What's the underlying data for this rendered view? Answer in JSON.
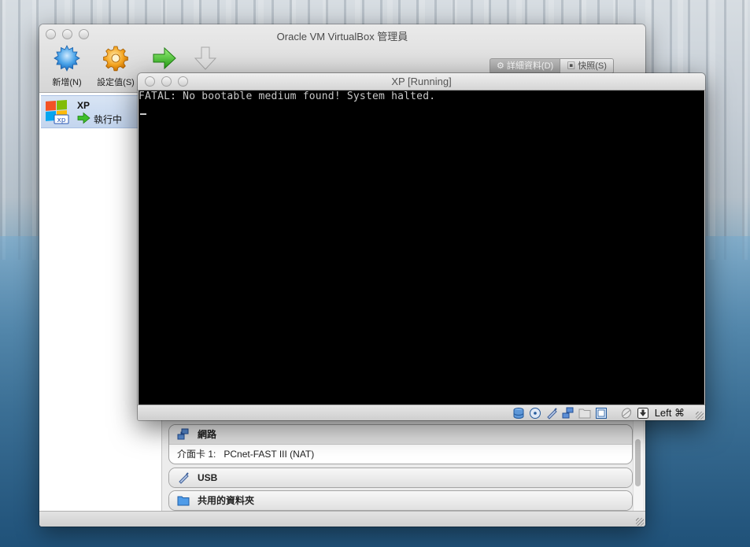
{
  "manager": {
    "title": "Oracle VM VirtualBox 管理員",
    "toolbar": {
      "new_label": "新增(N)",
      "settings_label": "設定值(S)",
      "start_label": "",
      "discard_label": ""
    },
    "segmented": {
      "details_label": "詳細資料(D)",
      "snapshots_label": "快照(S)"
    },
    "vm_list": [
      {
        "name": "XP",
        "state": "執行中",
        "state_icon": "green-arrow-icon"
      }
    ],
    "details": {
      "network": {
        "header": "網路",
        "rows": [
          {
            "label": "介面卡 1:",
            "value": "PCnet-FAST III (NAT)"
          }
        ]
      },
      "usb": {
        "header": "USB"
      },
      "shared_folders": {
        "header": "共用的資料夾"
      }
    }
  },
  "vm_window": {
    "title": "XP [Running]",
    "console_text": "FATAL: No bootable medium found! System halted.",
    "host_key": "Left ⌘",
    "status_icons": [
      "hard-disk-icon",
      "optical-disk-icon",
      "usb-icon",
      "network-icon",
      "shared-folder-icon",
      "display-icon",
      "mouse-integration-icon",
      "host-key-arrow-icon"
    ]
  },
  "colors": {
    "console_bg": "#000000",
    "console_text": "#c9c9c9",
    "selection": "#c3d5ee",
    "start_green": "#39b71f"
  }
}
